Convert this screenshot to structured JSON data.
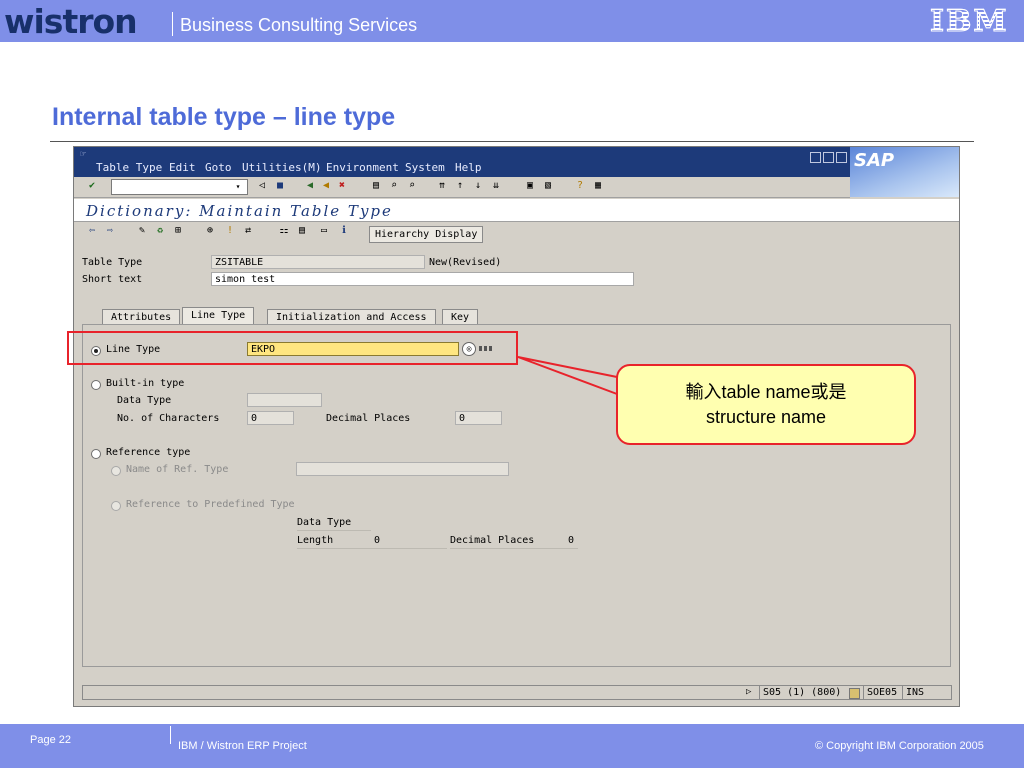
{
  "header": {
    "logo": "wistron",
    "title": "Business Consulting Services",
    "brand": "IBM"
  },
  "slide": {
    "title": "Internal table type – line type"
  },
  "sap": {
    "menu": [
      "Table Type",
      "Edit",
      "Goto",
      "Utilities(M)",
      "Environment",
      "System",
      "Help"
    ],
    "logo": "SAP",
    "screen_title": "Dictionary: Maintain Table Type",
    "hierarchy_button": "Hierarchy Display",
    "table_type_label": "Table Type",
    "table_type_value": "ZSITABLE",
    "table_type_status": "New(Revised)",
    "short_text_label": "Short text",
    "short_text_value": "simon test",
    "tabs": [
      "Attributes",
      "Line Type",
      "Initialization and Access",
      "Key"
    ],
    "active_tab": "Line Type",
    "line_type_label": "Line Type",
    "line_type_value": "EKPO",
    "builtin_label": "Built-in type",
    "data_type_label": "Data Type",
    "num_chars_label": "No. of Characters",
    "num_chars_value": "0",
    "decimal_places_label": "Decimal Places",
    "decimal_places_value": "0",
    "reference_label": "Reference type",
    "name_ref_label": "Name of Ref. Type",
    "ref_predef_label": "Reference to Predefined Type",
    "data_type2_label": "Data Type",
    "length_label": "Length",
    "length_value": "0",
    "decimal_places2_label": "Decimal Places",
    "decimal_places2_value": "0",
    "status": {
      "session": "S05 (1) (800)",
      "server": "SOE05",
      "mode": "INS"
    }
  },
  "callout": {
    "line1": "輸入table name或是",
    "line2": "structure name"
  },
  "footer": {
    "page": "Page 22",
    "project": "IBM / Wistron ERP Project",
    "copyright": "© Copyright IBM Corporation 2005"
  },
  "colors": {
    "header_band": "#7f8fe8",
    "title_blue": "#4e6bd8",
    "highlight_red": "#e8232b",
    "callout_fill": "#ffffb0",
    "sap_menubar": "#1d3a7a"
  }
}
